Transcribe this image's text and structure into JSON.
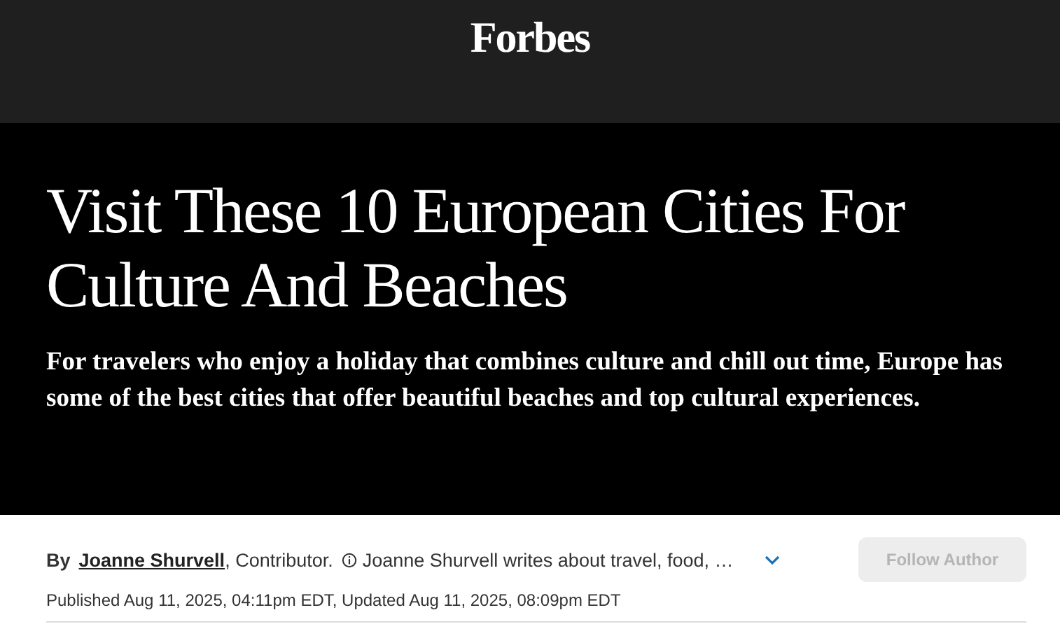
{
  "header": {
    "logo": "Forbes"
  },
  "article": {
    "title": "Visit These 10 European Cities For Culture And Beaches",
    "subtitle": "For travelers who enjoy a holiday that combines culture and chill out time, Europe has some of the best cities that offer beautiful beaches and top cultural experiences."
  },
  "byline": {
    "by": "By",
    "author": "Joanne Shurvell",
    "role": ", Contributor.",
    "bio": "Joanne Shurvell writes about travel, food, …",
    "expanded": false,
    "follow_button": {
      "label": "Follow Author",
      "disabled": true
    },
    "dates": "Published Aug 11, 2025, 04:11pm EDT, Updated Aug 11, 2025, 08:09pm EDT"
  }
}
